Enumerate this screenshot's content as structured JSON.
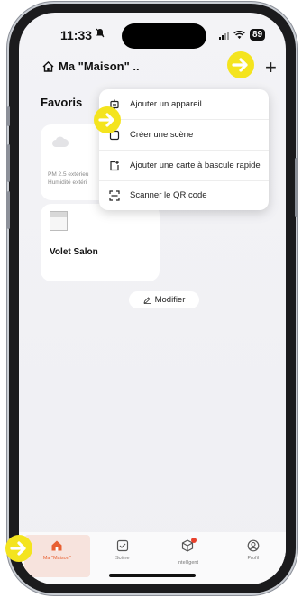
{
  "status_bar": {
    "time": "11:33",
    "battery": "89"
  },
  "header": {
    "title": "Ma \"Maison\" ..",
    "plus": "+"
  },
  "section_title": "Favoris",
  "weather_card": {
    "line1": "PM 2.5 extérieu",
    "line2": "Humidité extéri"
  },
  "volet_card": {
    "label": "Volet Salon"
  },
  "modifier_label": "Modifier",
  "menu": {
    "items": [
      {
        "icon": "add-device-icon",
        "label": "Ajouter un appareil"
      },
      {
        "icon": "create-scene-icon",
        "label": "Créer une scène"
      },
      {
        "icon": "add-card-icon",
        "label": "Ajouter une carte à bascule rapide"
      },
      {
        "icon": "qr-scan-icon",
        "label": "Scanner le QR code"
      }
    ]
  },
  "tabbar": {
    "items": [
      {
        "icon": "home-icon",
        "label": "Ma \"Maison\""
      },
      {
        "icon": "scene-icon",
        "label": "Scène"
      },
      {
        "icon": "smart-icon",
        "label": "Intelligent"
      },
      {
        "icon": "profile-icon",
        "label": "Profil"
      }
    ]
  },
  "colors": {
    "accent": "#e86032",
    "highlight_arrow": "#f4e41e",
    "notification_dot": "#e8412c"
  }
}
